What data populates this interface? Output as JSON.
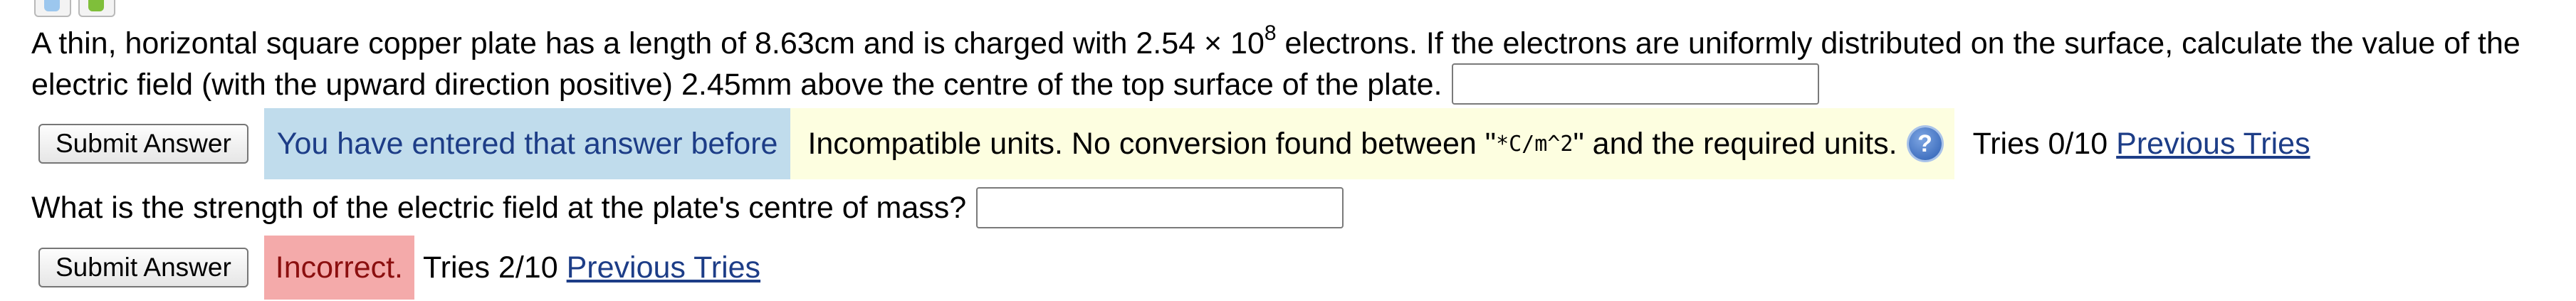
{
  "toolbar": {
    "icons": [
      "pencil-icon",
      "database-icon"
    ]
  },
  "question": {
    "text_before_exp": "A thin, horizontal square copper plate has a length of 8.63cm and is charged with 2.54 × 10",
    "exponent": "8",
    "text_after_exp": " electrons. If the electrons are uniformly distributed on the surface, calculate the value of the electric field (with the upward direction positive) 2.45mm above the centre of the top surface of the plate."
  },
  "part1": {
    "submit_label": "Submit Answer",
    "duplicate_msg": "You have entered that answer before",
    "units_msg_before": "Incompatible units. No conversion found between \"",
    "units_code": "*C/m^2",
    "units_msg_after": "\" and the required units.",
    "help_icon": "?",
    "tries": "Tries 0/10",
    "prev_tries": "Previous Tries"
  },
  "part2": {
    "question": "What is the strength of the electric field at the plate's centre of mass?",
    "submit_label": "Submit Answer",
    "incorrect_msg": "Incorrect.",
    "tries": "Tries 2/10",
    "prev_tries": "Previous Tries"
  },
  "colors": {
    "duplicate_bg": "#c0dcec",
    "units_bg": "#fdfee0",
    "incorrect_bg": "#f4aaaa",
    "link": "#1d3d87"
  }
}
